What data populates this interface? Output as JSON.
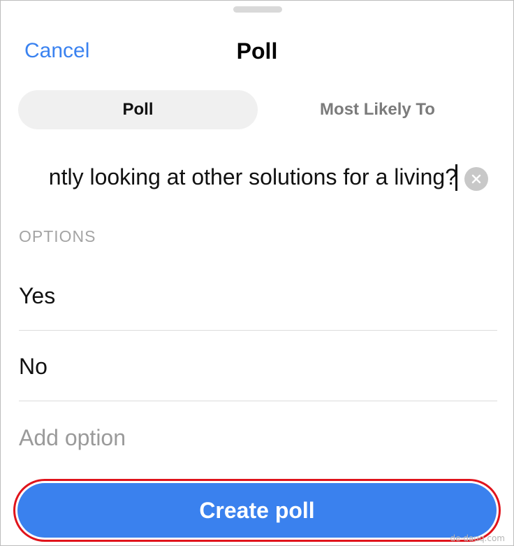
{
  "header": {
    "cancel_label": "Cancel",
    "title": "Poll"
  },
  "segmented_control": {
    "tabs": [
      {
        "label": "Poll",
        "selected": true
      },
      {
        "label": "Most Likely To",
        "selected": false
      }
    ]
  },
  "question": {
    "visible_text": "ntly looking at other solutions for a living?"
  },
  "options": {
    "header": "OPTIONS",
    "items": [
      {
        "value": "Yes"
      },
      {
        "value": "No"
      }
    ],
    "add_placeholder": "Add option"
  },
  "create_button": {
    "label": "Create poll"
  },
  "watermark": "de·dauq.com",
  "colors": {
    "accent": "#3a82f0",
    "button_bg": "#3a81ee",
    "highlight_border": "#e0141c"
  },
  "icons": {
    "clear": "close-icon",
    "grabber": "drag-handle-icon"
  }
}
